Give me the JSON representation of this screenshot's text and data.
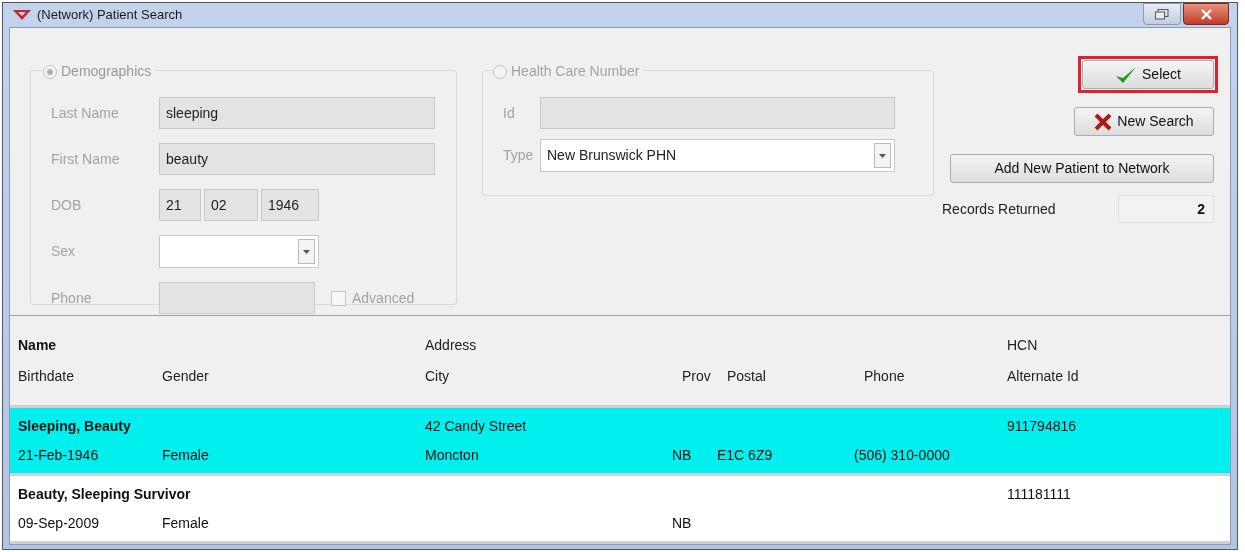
{
  "window": {
    "title": "(Network) Patient Search"
  },
  "demographics": {
    "label": "Demographics",
    "selected": true,
    "last_name": {
      "label": "Last Name",
      "value": "sleeping"
    },
    "first_name": {
      "label": "First Name",
      "value": "beauty"
    },
    "dob": {
      "label": "DOB",
      "day": "21",
      "month": "02",
      "year": "1946"
    },
    "sex": {
      "label": "Sex"
    },
    "phone": {
      "label": "Phone"
    },
    "advanced": {
      "label": "Advanced",
      "checked": false
    }
  },
  "health_care_number": {
    "label": "Health Care Number",
    "selected": false,
    "id": {
      "label": "Id"
    },
    "type": {
      "label": "Type",
      "value": "New Brunswick PHN"
    }
  },
  "buttons": [
    {
      "kind": "select",
      "label": "Select",
      "highlighted": true
    },
    {
      "kind": "new_search",
      "label": "New Search",
      "highlighted": false
    },
    {
      "kind": "add",
      "label": "Add New Patient to Network",
      "highlighted": false
    }
  ],
  "records_returned": {
    "label": "Records Returned",
    "value": "2"
  },
  "table": {
    "header_top": [
      "Name",
      "Address",
      "HCN"
    ],
    "header_bottom": [
      "Birthdate",
      "Gender",
      "City",
      "Prov",
      "Postal",
      "Phone",
      "Alternate Id"
    ],
    "rows": [
      {
        "name": "Sleeping, Beauty",
        "address": "42 Candy Street",
        "hcn": "911794816",
        "birthdate": "21-Feb-1946",
        "gender": "Female",
        "city": "Moncton",
        "prov": "NB",
        "postal": "E1C 6Z9",
        "phone": "(506) 310-0000",
        "selected": true
      },
      {
        "name": "Beauty, Sleeping Survivor",
        "hcn": "111181111",
        "birthdate": "09-Sep-2009",
        "gender": "Female",
        "prov": "NB",
        "selected": false
      }
    ]
  }
}
